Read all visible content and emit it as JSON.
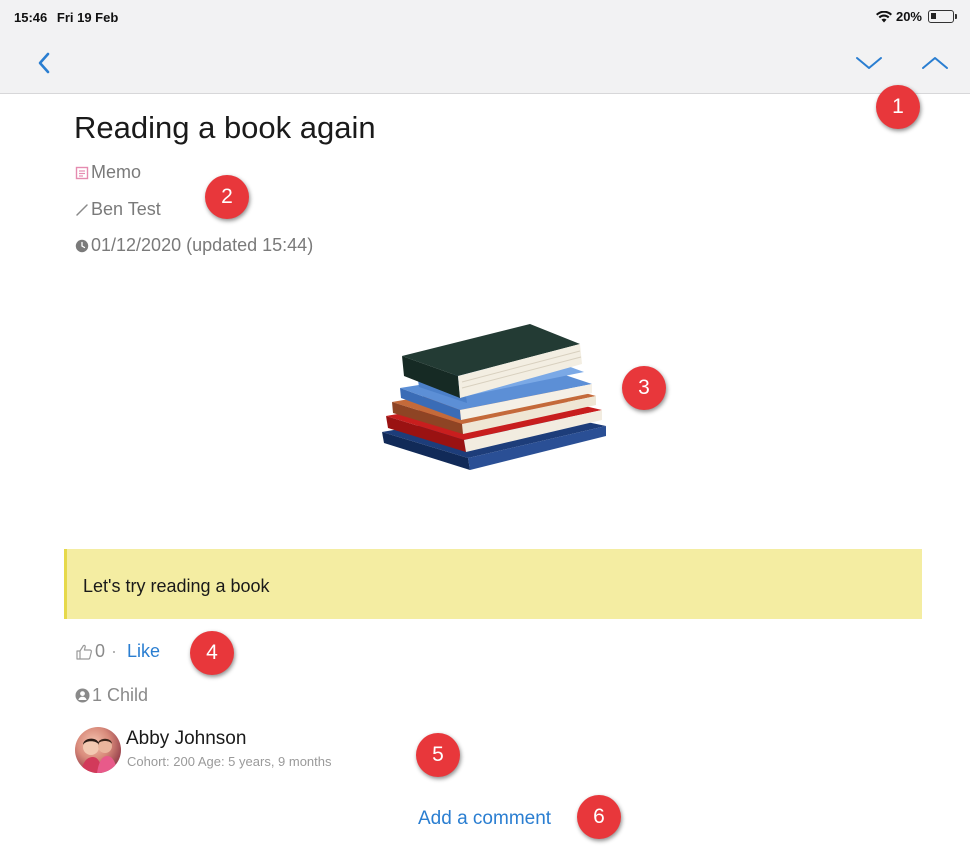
{
  "status_bar": {
    "time": "15:46",
    "date": "Fri 19 Feb",
    "battery": "20%"
  },
  "nav": {
    "back_icon": "chevron-left-icon",
    "next_icon": "chevron-down-icon",
    "prev_icon": "chevron-up-icon"
  },
  "post": {
    "title": "Reading a book again",
    "type_label": "Memo",
    "author": "Ben Test",
    "date_line": "01/12/2020 (updated 15:44)",
    "image_icon": "books-stack-image",
    "note": "Let's try reading a book",
    "like_count": "0",
    "like_separator": "·",
    "like_label": "Like",
    "children_label": "1 Child"
  },
  "child": {
    "name": "Abby Johnson",
    "details": "Cohort: 200 Age: 5 years, 9 months"
  },
  "comment": {
    "label": "Add a comment"
  },
  "badges": [
    "1",
    "2",
    "3",
    "4",
    "5",
    "6"
  ],
  "colors": {
    "accent_blue": "#2a7ed1",
    "badge_red": "#e8373b",
    "note_yellow": "#f4eda2"
  }
}
